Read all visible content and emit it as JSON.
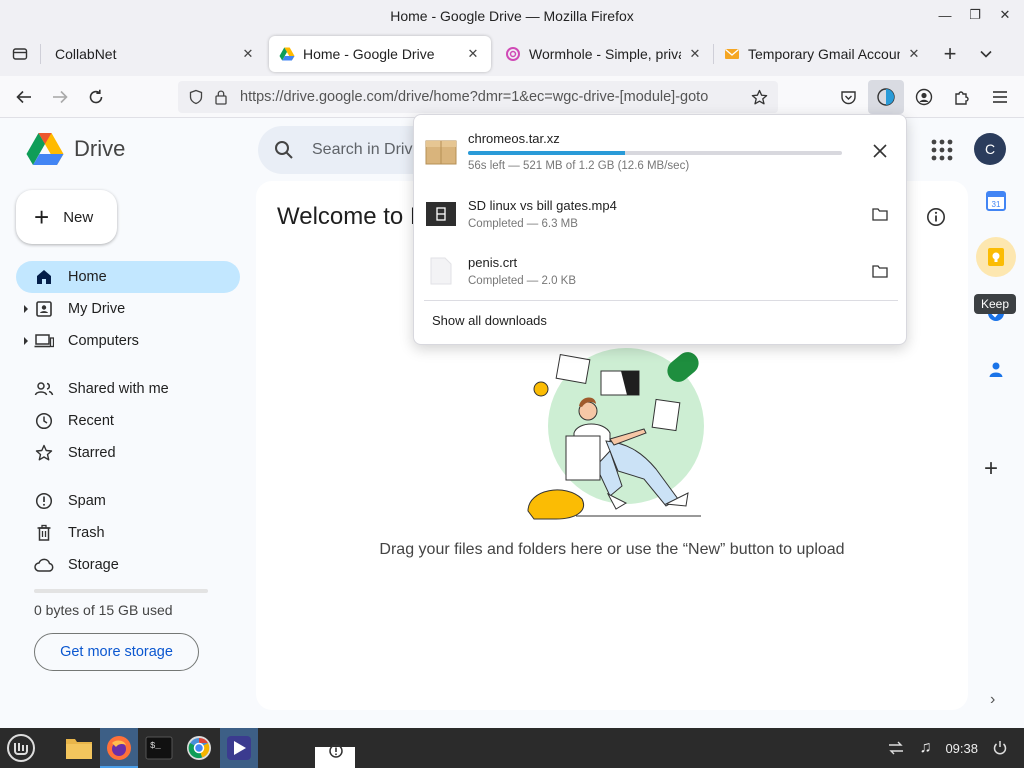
{
  "window": {
    "title": "Home - Google Drive — Mozilla Firefox"
  },
  "tabs": [
    {
      "label": "CollabNet",
      "active": false
    },
    {
      "label": "Home - Google Drive",
      "active": true
    },
    {
      "label": "Wormhole - Simple, private",
      "active": false
    },
    {
      "label": "Temporary Gmail Account |",
      "active": false
    }
  ],
  "navbar": {
    "url": "https://drive.google.com/drive/home?dmr=1&ec=wgc-drive-[module]-goto"
  },
  "drive": {
    "logo_text": "Drive",
    "search_placeholder": "Search in Drive",
    "avatar_letter": "C",
    "new_label": "New",
    "nav": [
      {
        "label": "Home"
      },
      {
        "label": "My Drive"
      },
      {
        "label": "Computers"
      },
      {
        "label": "Shared with me"
      },
      {
        "label": "Recent"
      },
      {
        "label": "Starred"
      },
      {
        "label": "Spam"
      },
      {
        "label": "Trash"
      },
      {
        "label": "Storage"
      }
    ],
    "storage_text": "0 bytes of 15 GB used",
    "get_storage_label": "Get more storage",
    "welcome": "Welcome to Drive",
    "drag_text": "Drag your files and folders here or use the “New” button to upload",
    "keep_tooltip": "Keep"
  },
  "downloads": {
    "items": [
      {
        "name": "chromeos.tar.xz",
        "status": "56s left — 521 MB of 1.2 GB (12.6 MB/sec)",
        "progress": 0.42
      },
      {
        "name": "SD linux vs bill gates.mp4",
        "status": "Completed — 6.3 MB"
      },
      {
        "name": "penis.crt",
        "status": "Completed — 2.0 KB"
      }
    ],
    "show_all": "Show all downloads"
  },
  "taskbar": {
    "clock": "09:38"
  },
  "colors": {
    "accent": "#0b57d0",
    "selected_nav": "#c2e7ff",
    "progress": "#2a9bd8"
  }
}
